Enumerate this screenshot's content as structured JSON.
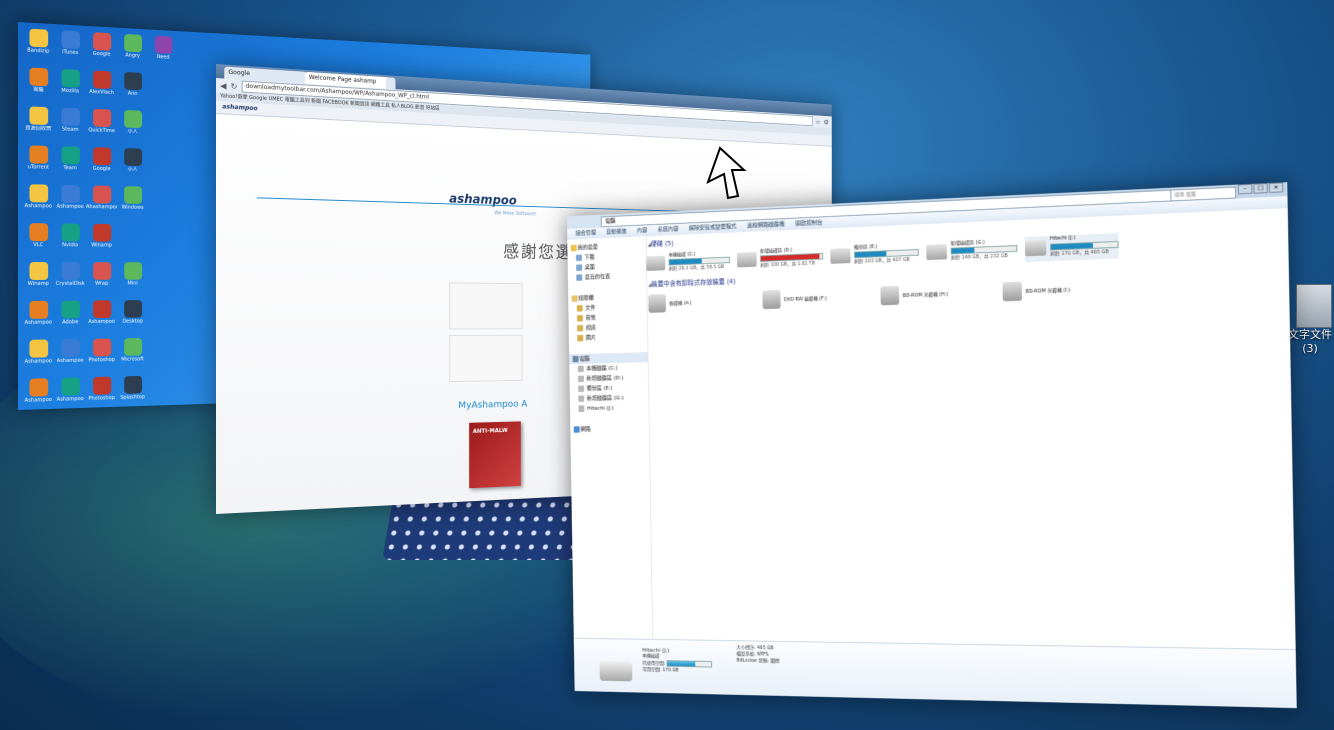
{
  "desktop_icons": [
    {
      "label": "Bandizip"
    },
    {
      "label": "iTunes"
    },
    {
      "label": "Google"
    },
    {
      "label": "Angry"
    },
    {
      "label": "Need"
    },
    {
      "label": "電腦"
    },
    {
      "label": "Mozilla"
    },
    {
      "label": "AlexVlach"
    },
    {
      "label": "Ann"
    },
    {
      "label": ""
    },
    {
      "label": "資源回收筒"
    },
    {
      "label": "Steam"
    },
    {
      "label": "QuickTime"
    },
    {
      "label": "小人"
    },
    {
      "label": ""
    },
    {
      "label": "uTorrent"
    },
    {
      "label": "Team"
    },
    {
      "label": "Google"
    },
    {
      "label": "小人"
    },
    {
      "label": ""
    },
    {
      "label": "Ashampoo"
    },
    {
      "label": "Ashampoo"
    },
    {
      "label": "Ahashampoo"
    },
    {
      "label": "Windows"
    },
    {
      "label": ""
    },
    {
      "label": "VLC"
    },
    {
      "label": "Nvidia"
    },
    {
      "label": "Winamp"
    },
    {
      "label": ""
    },
    {
      "label": ""
    },
    {
      "label": "Winamp"
    },
    {
      "label": "CrystalDisk"
    },
    {
      "label": "Wrap"
    },
    {
      "label": "Mini"
    },
    {
      "label": ""
    },
    {
      "label": "Ashampoo"
    },
    {
      "label": "Adobe"
    },
    {
      "label": "Ashampoo"
    },
    {
      "label": "Desktop"
    },
    {
      "label": ""
    },
    {
      "label": "Ashampoo"
    },
    {
      "label": "Ashampoo"
    },
    {
      "label": "Photoshop"
    },
    {
      "label": "Microsoft"
    },
    {
      "label": ""
    },
    {
      "label": "Ashampoo"
    },
    {
      "label": "Ashampoo"
    },
    {
      "label": "Photoshop"
    },
    {
      "label": "Splashtop"
    },
    {
      "label": ""
    }
  ],
  "desktop_doc": {
    "label": "文字文件",
    "count": "(3)"
  },
  "browser": {
    "tab1": "Google",
    "tab2": "Welcome Page ashamp",
    "url": "downloadmytoolbar.com/Ashampoo/WP/Ashampoo_WP_cl.html",
    "bookmarks": "Yahoo!奇摩  Google  UMEC  電腦工具列  新聞  FACEBOOK  新聞資訊  網路工具  私人BLOG  影音  好站區",
    "toolbar_brand": "ashampoo",
    "brand": "ashampoo",
    "tagline": "We Make Software!",
    "welcome": "感謝您選擇我們的",
    "myashampoo": "MyAshampoo A",
    "boxart": "ANTI-MALW"
  },
  "explorer": {
    "address": "電腦",
    "search_placeholder": "搜尋 電腦",
    "commands": [
      "組合管理",
      "自動播放",
      "內容",
      "系統內容",
      "解除安裝或變更程式",
      "連線網路磁碟機",
      "開啟控制台"
    ],
    "nav": {
      "favorites": "我的最愛",
      "fav_items": [
        "下載",
        "桌面",
        "最近的位置"
      ],
      "libraries": "媒體櫃",
      "lib_items": [
        "文件",
        "音樂",
        "視訊",
        "圖片"
      ],
      "computer": "電腦",
      "comp_items": [
        "本機磁碟 (C:)",
        "新增磁碟區 (D:)",
        "備份區 (E:)",
        "新增磁碟區 (G:)",
        "Hitachi (J:)"
      ],
      "network": "網路"
    },
    "hdd_group": "硬碟 (5)",
    "drives": [
      {
        "name": "本機磁碟 (C:)",
        "free": "剩餘 26.1 GB，共 58.5 GB",
        "used_pct": 55,
        "color": "#1f8bc2"
      },
      {
        "name": "新增磁碟區 (D:)",
        "free": "剩餘 100 GB，共 1.81 TB",
        "used_pct": 95,
        "color": "#d42a2a"
      },
      {
        "name": "備份區 (E:)",
        "free": "剩餘 203 GB，共 407 GB",
        "used_pct": 50,
        "color": "#1f8bc2"
      },
      {
        "name": "新增磁碟區 (G:)",
        "free": "剩餘 148 GB，共 232 GB",
        "used_pct": 36,
        "color": "#1f8bc2"
      },
      {
        "name": "Hitachi (J:)",
        "free": "剩餘 170 GB，共 465 GB",
        "used_pct": 63,
        "color": "#1f8bc2"
      }
    ],
    "removable_group": "裝置中含有卸除式存放裝置 (4)",
    "removables": [
      {
        "name": "軟碟機 (A:)"
      },
      {
        "name": "DVD RW 磁碟機 (F:)"
      },
      {
        "name": "BD-ROM 光碟機 (H:)"
      },
      {
        "name": "BD-ROM 光碟機 (I:)"
      }
    ],
    "details": {
      "title": "Hitachi (J:)",
      "type": "本機磁碟",
      "used_label": "已使用空間:",
      "free_label": "可用空間:",
      "free_value": "170 GB",
      "used_pct": 63,
      "total_label": "大小總計:",
      "total_value": "465 GB",
      "fs_label": "檔案系統:",
      "fs_value": "NTFS",
      "bitlocker_label": "BitLocker 狀態:",
      "bitlocker_value": "關閉"
    }
  }
}
